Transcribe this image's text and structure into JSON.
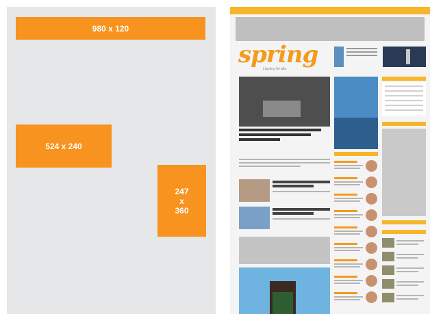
{
  "ad_sizes": {
    "leaderboard": "980 x 120",
    "module": "524 x 240",
    "sidebar": [
      "247",
      "x",
      "360"
    ]
  },
  "colors": {
    "accent": "#f7931e",
    "panel": "#e6e7e8",
    "site_bar": "#f7b52c"
  },
  "site": {
    "logo": "spring",
    "tagline": "Löpning för alla"
  }
}
